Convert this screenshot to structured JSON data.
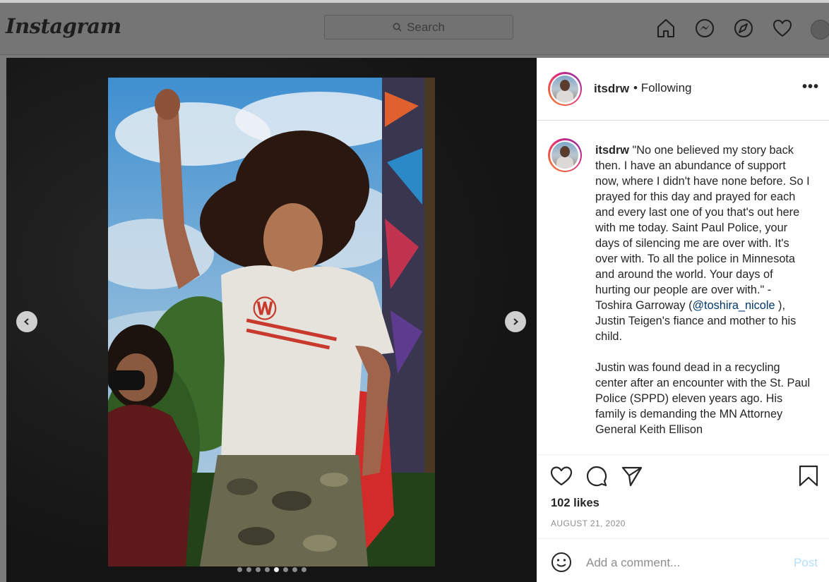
{
  "nav": {
    "logo": "Instagram",
    "search_placeholder": "Search",
    "icons": [
      "home-icon",
      "messenger-icon",
      "explore-icon",
      "activity-heart-icon",
      "profile-avatar"
    ]
  },
  "media": {
    "carousel_dots": 8,
    "active_dot": 4,
    "prev_icon": "chevron-left-icon",
    "next_icon": "chevron-right-icon"
  },
  "post": {
    "username": "itsdrw",
    "separator": "•",
    "following_label": "Following",
    "more_label": "•••",
    "caption_username": "itsdrw",
    "caption_part1": " \"No one believed my story back then. I have an abundance of support now, where I didn't have none before. So I prayed for this day and prayed for each and every last one of you that's out here with me today. Saint Paul Police, your days of silencing me are over with. It's over with. To all the police in Minnesota and around the world. Your days of hurting our people are over with.\" - Toshira Garroway (",
    "caption_mention": "@toshira_nicole",
    "caption_part2": " ), Justin Teigen's fiance and mother to his child.",
    "caption_paragraph2": "Justin was found dead in a recycling center after an encounter with the St. Paul Police (SPPD) eleven years ago. His family is demanding the MN Attorney General Keith Ellison",
    "likes": "102 likes",
    "date": "AUGUST 21, 2020",
    "comment_placeholder": "Add a comment...",
    "post_button": "Post",
    "colors": {
      "link": "#00376b",
      "post_disabled": "#b2dffc",
      "muted": "#8e8e8e"
    }
  }
}
